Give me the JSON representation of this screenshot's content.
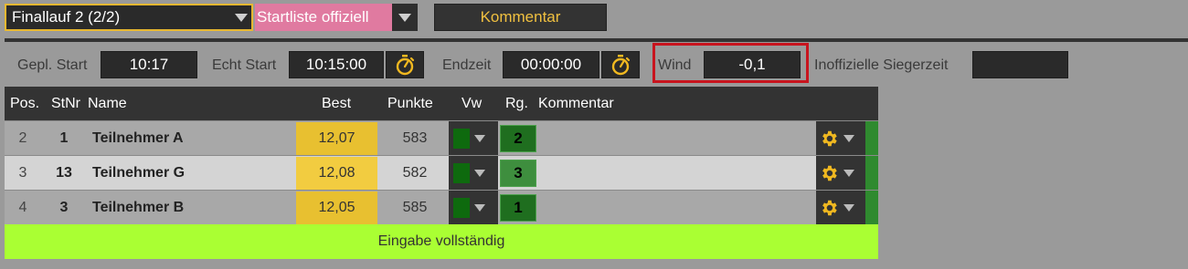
{
  "toolbar": {
    "heat_select_value": "Finallauf 2 (2/2)",
    "status_select_value": "Startliste offiziell",
    "kommentar_label": "Kommentar"
  },
  "timing": {
    "planned_start_label": "Gepl. Start",
    "planned_start_value": "10:17",
    "actual_start_label": "Echt Start",
    "actual_start_value": "10:15:00",
    "end_time_label": "Endzeit",
    "end_time_value": "00:00:00",
    "wind_label": "Wind",
    "wind_value": "-0,1",
    "unofficial_winner_label": "Inoffizielle Siegerzeit",
    "unofficial_winner_value": ""
  },
  "table": {
    "headers": {
      "pos": "Pos.",
      "stnr": "StNr",
      "name": "Name",
      "best": "Best",
      "punkte": "Punkte",
      "vw": "Vw",
      "rg": "Rg.",
      "kommentar": "Kommentar"
    },
    "rows": [
      {
        "pos": "2",
        "stnr": "1",
        "name": "Teilnehmer A",
        "best": "12,07",
        "punkte": "583",
        "rg": "2",
        "kommentar": ""
      },
      {
        "pos": "3",
        "stnr": "13",
        "name": "Teilnehmer G",
        "best": "12,08",
        "punkte": "582",
        "rg": "3",
        "kommentar": ""
      },
      {
        "pos": "4",
        "stnr": "3",
        "name": "Teilnehmer B",
        "best": "12,05",
        "punkte": "585",
        "rg": "1",
        "kommentar": ""
      }
    ],
    "footer_status": "Eingabe vollständig"
  },
  "colors": {
    "accent_yellow": "#e8c030",
    "status_pink": "#e07aa0",
    "complete_green": "#aaff33",
    "highlight_red": "#c8141e"
  },
  "icons": {
    "stopwatch": "stopwatch-icon",
    "gear": "gear-icon",
    "dropdown": "chevron-down-icon"
  }
}
